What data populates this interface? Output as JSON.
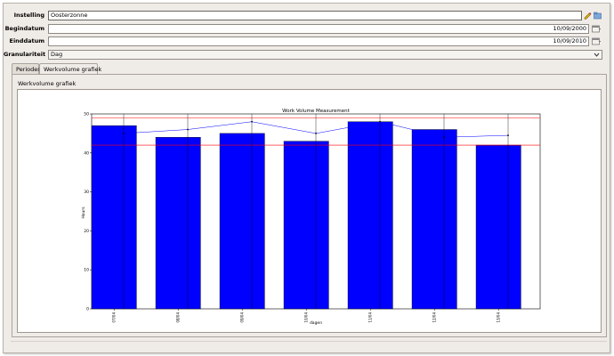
{
  "form": {
    "instelling_label": "Instelling",
    "instelling_value": "Oosterzonne",
    "begindatum_label": "Begindatum",
    "begindatum_value": "10/09/2000",
    "einddatum_label": "Einddatum",
    "einddatum_value": "10/09/2010",
    "granulariteit_label": "Granulariteit",
    "granulariteit_value": "Dag"
  },
  "tabs": [
    {
      "label": "Periodes",
      "active": false
    },
    {
      "label": "Werkvolume grafiek",
      "active": true
    }
  ],
  "panel": {
    "title": "Werkvolume grafiek"
  },
  "icons": {
    "instelling_edit": "pencil-icon",
    "instelling_browse": "folder-icon",
    "begindatum_calendar": "calendar-icon",
    "einddatum_calendar": "calendar-icon",
    "granulariteit_dropdown": "chevron-down-icon"
  },
  "colors": {
    "bar": "#0000ff",
    "line": "#0000ff",
    "threshold": "#ff0000"
  },
  "chart_data": {
    "type": "bar",
    "title": "Work Volume Measurement",
    "xlabel": "dagen",
    "ylabel": "Hours",
    "ylim": [
      0,
      50
    ],
    "yticks": [
      0,
      10,
      20,
      30,
      40,
      50
    ],
    "categories": [
      "07/04",
      "08/04",
      "09/04",
      "10/04",
      "11/04",
      "12/04",
      "13/04"
    ],
    "values": [
      47,
      44,
      45,
      43,
      48,
      46,
      42
    ],
    "line_values": [
      45,
      46,
      48,
      45,
      48,
      44,
      44.5
    ],
    "threshold_lines": [
      49,
      42
    ],
    "grid": false
  }
}
